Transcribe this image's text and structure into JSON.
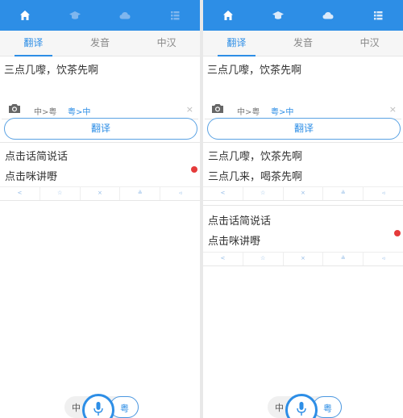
{
  "colors": {
    "accent": "#2d8ee6",
    "record_dot": "#e53b3b"
  },
  "nav_icons": [
    "home-icon",
    "graduation-cap-icon",
    "cloud-icon",
    "list-icon"
  ],
  "tabs": [
    "翻译",
    "发音",
    "中汉"
  ],
  "input": {
    "text": "三点几嚟，饮茶先啊",
    "dir_cn_yue": "中>粤",
    "dir_yue_cn": "粤>中",
    "clear": "×"
  },
  "translate_button": "翻译",
  "actions": [
    "share-icon",
    "star-icon",
    "delete-icon",
    "user-add-icon",
    "speaker-icon"
  ],
  "action_glyphs": [
    "<",
    "☆",
    "×",
    "≗",
    "◃"
  ],
  "mic": {
    "left_lang": "中",
    "right_lang": "粤"
  },
  "screens": [
    {
      "cards": [
        {
          "lines": [
            "点击话简说话",
            "点击咪讲嘢"
          ]
        }
      ]
    },
    {
      "cards": [
        {
          "lines": [
            "三点几嚟，饮茶先啊",
            "三点几来，喝茶先啊"
          ]
        },
        {
          "lines": [
            "点击话简说话",
            "点击咪讲嘢"
          ]
        }
      ]
    }
  ]
}
